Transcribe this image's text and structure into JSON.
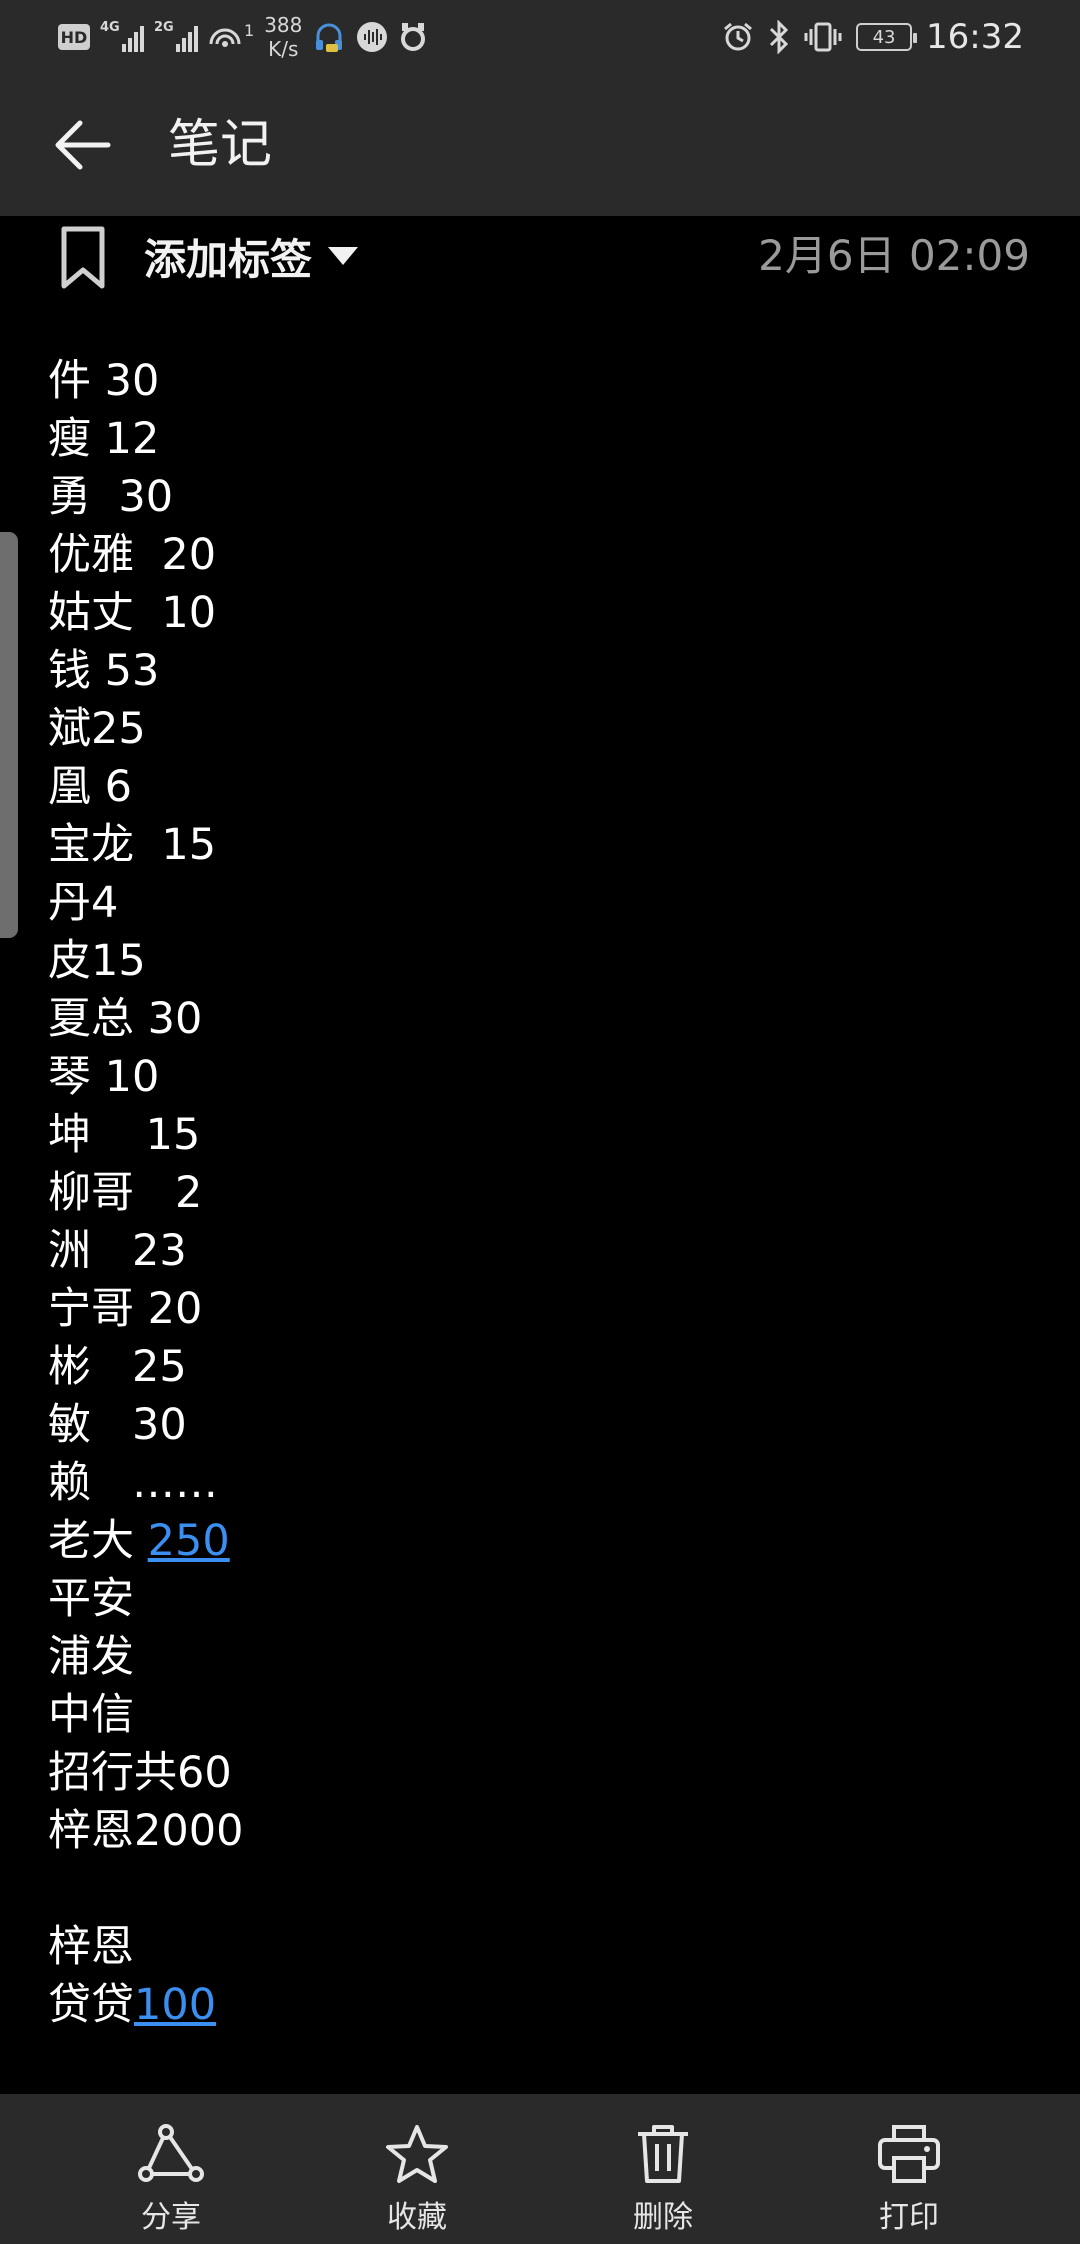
{
  "status_bar": {
    "hd_badge": "HD",
    "sim1_gen": "4G",
    "sim2_gen": "2G",
    "hotspot_count": "1",
    "speed_value": "388",
    "speed_unit": "K/s",
    "battery": "43",
    "time": "16:32"
  },
  "app_bar": {
    "title": "笔记"
  },
  "note": {
    "tag_label": "添加标签",
    "date": "2月6日 02:09",
    "lines": [
      {
        "text": "件 30",
        "link": ""
      },
      {
        "text": "瘦 12",
        "link": ""
      },
      {
        "text": "勇  30",
        "link": ""
      },
      {
        "text": "优雅  20",
        "link": ""
      },
      {
        "text": "姑丈  10",
        "link": ""
      },
      {
        "text": "钱 53",
        "link": ""
      },
      {
        "text": "斌25",
        "link": ""
      },
      {
        "text": "凰 6",
        "link": ""
      },
      {
        "text": "宝龙  15",
        "link": ""
      },
      {
        "text": "丹4",
        "link": ""
      },
      {
        "text": "皮15",
        "link": ""
      },
      {
        "text": "夏总 30",
        "link": ""
      },
      {
        "text": "琴 10",
        "link": ""
      },
      {
        "text": "坤    15",
        "link": ""
      },
      {
        "text": "柳哥   2",
        "link": ""
      },
      {
        "text": "洲   23",
        "link": ""
      },
      {
        "text": "宁哥 20",
        "link": ""
      },
      {
        "text": "彬   25",
        "link": ""
      },
      {
        "text": "敏   30",
        "link": ""
      },
      {
        "text": "赖   ……",
        "link": ""
      },
      {
        "text": "老大 ",
        "link": "250"
      },
      {
        "text": "平安",
        "link": ""
      },
      {
        "text": "浦发",
        "link": ""
      },
      {
        "text": "中信",
        "link": ""
      },
      {
        "text": "招行共60",
        "link": ""
      },
      {
        "text": "梓恩2000",
        "link": ""
      },
      {
        "text": "",
        "link": ""
      },
      {
        "text": "梓恩",
        "link": ""
      },
      {
        "text": "贷贷",
        "link": "100"
      }
    ]
  },
  "bottom_bar": {
    "share": "分享",
    "favorite": "收藏",
    "delete": "删除",
    "print": "打印"
  }
}
